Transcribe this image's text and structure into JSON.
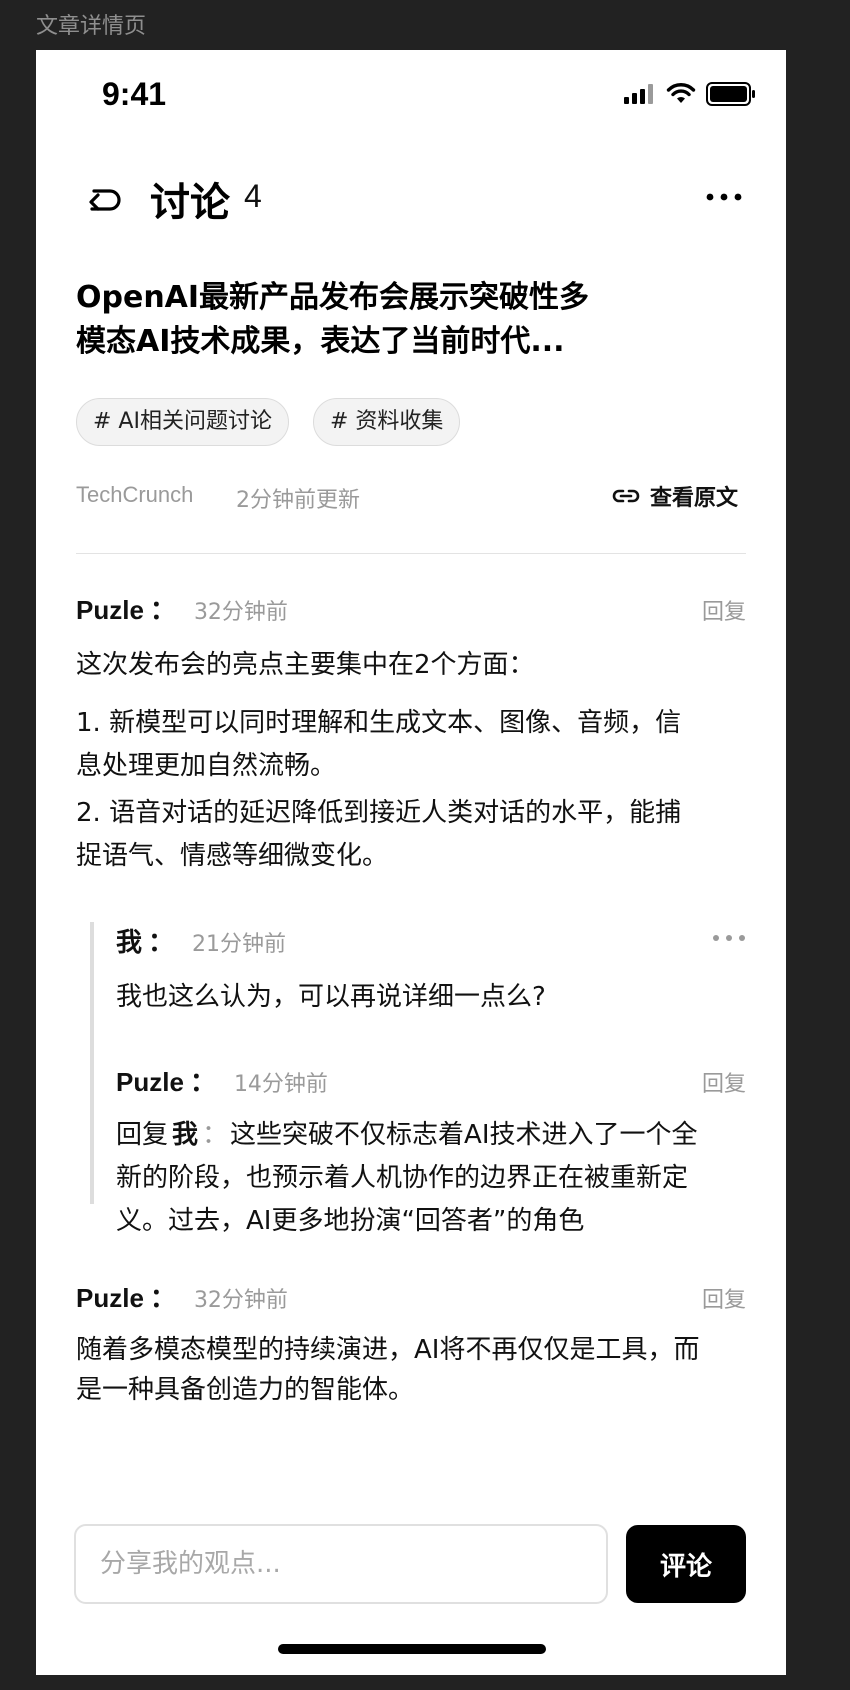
{
  "frame_label": "文章详情页",
  "status_bar": {
    "time": "9:41"
  },
  "header": {
    "title": "讨论",
    "count": "4"
  },
  "article": {
    "title_line1": "OpenAI最新产品发布会展示突破性多",
    "title_line2": "模态AI技术成果，表达了当前时代...",
    "tags": [
      "# AI相关问题讨论",
      "# 资料收集"
    ],
    "source": "TechCrunch",
    "updated": "2分钟前更新",
    "view_original": "查看原文"
  },
  "comments": [
    {
      "author": "Puzle",
      "colon": "：",
      "time": "32分钟前",
      "reply_label": "回复",
      "lines": [
        "这次发布会的亮点主要集中在2个方面：",
        "1. 新模型可以同时理解和生成文本、图像、音频，信",
        "息处理更加自然流畅。",
        "2. 语音对话的延迟降低到接近人类对话的水平，能捕",
        "捉语气、情感等细微变化。"
      ]
    },
    {
      "author": "我",
      "colon": "：",
      "time": "21分钟前",
      "lines": [
        "我也这么认为，可以再说详细一点么?"
      ]
    },
    {
      "author": "Puzle",
      "colon": "：",
      "time": "14分钟前",
      "reply_label": "回复",
      "reply_prefix": "回复",
      "reply_to": "我",
      "reply_colon": "：",
      "line1_rest": "这些突破不仅标志着AI技术进入了一个全",
      "lines": [
        "新的阶段，也预示着人机协作的边界正在被重新定",
        "义。过去，AI更多地扮演“回答者”的角色"
      ]
    },
    {
      "author": "Puzle",
      "colon": "：",
      "time": "32分钟前",
      "reply_label": "回复",
      "lines": [
        "随着多模态模型的持续演进，AI将不再仅仅是工具，而",
        "是一种具备创造力的智能体。"
      ]
    }
  ],
  "composer": {
    "placeholder": "分享我的观点...",
    "submit_label": "评论"
  }
}
